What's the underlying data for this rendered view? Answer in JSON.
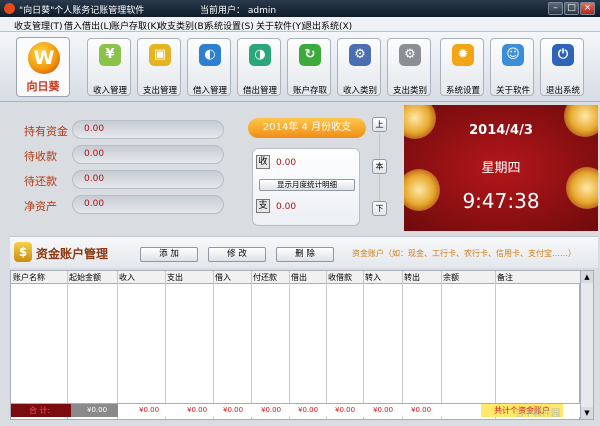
{
  "window": {
    "title": "\"向日葵\"个人账务记账管理软件",
    "user_label": "当前用户：",
    "user": "admin",
    "min": "–",
    "max": "□",
    "close": "×"
  },
  "menu": [
    "收支管理(T)",
    "借入借出(L)",
    "账户存取(K)",
    "收支类别(B)",
    "系统设置(S)",
    "关于软件(Y)",
    "退出系统(X)"
  ],
  "logo": {
    "glyph": "W",
    "name": "向日葵"
  },
  "toolbar": [
    {
      "label": "收入管理",
      "icon": "income-coins-icon",
      "glyph": "¥",
      "color": "#8bc34a"
    },
    {
      "label": "支出管理",
      "icon": "expense-box-icon",
      "glyph": "▣",
      "color": "#e6b422"
    },
    {
      "label": "借入管理",
      "icon": "borrow-globe-icon",
      "glyph": "◐",
      "color": "#2f7fd0"
    },
    {
      "label": "借出管理",
      "icon": "lend-globe-icon",
      "glyph": "◑",
      "color": "#2aa77a"
    },
    {
      "label": "账户存取",
      "icon": "account-refresh-icon",
      "glyph": "↻",
      "color": "#3cab3c"
    },
    {
      "label": "收入类别",
      "icon": "income-category-icon",
      "glyph": "⚙",
      "color": "#4a6fb0"
    },
    {
      "label": "支出类别",
      "icon": "expense-category-icon",
      "glyph": "⚙",
      "color": "#8a8f96"
    },
    {
      "label": "系统设置",
      "icon": "settings-gear-icon",
      "glyph": "✹",
      "color": "#f2a516"
    },
    {
      "label": "关于软件",
      "icon": "about-users-icon",
      "glyph": "☺",
      "color": "#3a8fd8"
    },
    {
      "label": "退出系统",
      "icon": "exit-icon",
      "glyph": "⏻",
      "color": "#2f63b8"
    }
  ],
  "summary": [
    {
      "label": "持有资金",
      "value": "0.00"
    },
    {
      "label": "待收款",
      "value": "0.00"
    },
    {
      "label": "待还款",
      "value": "0.00"
    },
    {
      "label": "净资产",
      "value": "0.00"
    }
  ],
  "month": {
    "year": "2014",
    "year_suffix": "年",
    "month": "4",
    "month_suffix": "月份收支",
    "income_icon": "收",
    "income_value": "0.00",
    "show_detail": "显示月度统计明细",
    "expense_icon": "支",
    "expense_value": "0.00",
    "nav_up": "上",
    "nav_current": "本",
    "nav_down": "下"
  },
  "clock": {
    "date": "2014/4/3",
    "weekday": "星期四",
    "time": "9:47:38"
  },
  "accounts": {
    "title": "资金账户管理",
    "add": "添  加",
    "edit": "修  改",
    "delete": "删  除",
    "hint": "资金账户（如：现金、工行卡、农行卡、信用卡、支付宝……）",
    "columns": [
      "账户名称",
      "起始金额",
      "收入",
      "支出",
      "借入",
      "付还款",
      "借出",
      "收借款",
      "转入",
      "转出",
      "余额",
      "备注"
    ],
    "total_label": "合  计:",
    "totals": [
      "¥0.00",
      "¥0.00",
      "¥0.00",
      "¥0.00",
      "¥0.00",
      "¥0.00",
      "¥0.00",
      "¥0.00",
      "¥0.00"
    ],
    "total_count": "共计个资金账户"
  },
  "scroll": {
    "up": "▲",
    "down": "▼"
  },
  "watermark": "当下软件园"
}
